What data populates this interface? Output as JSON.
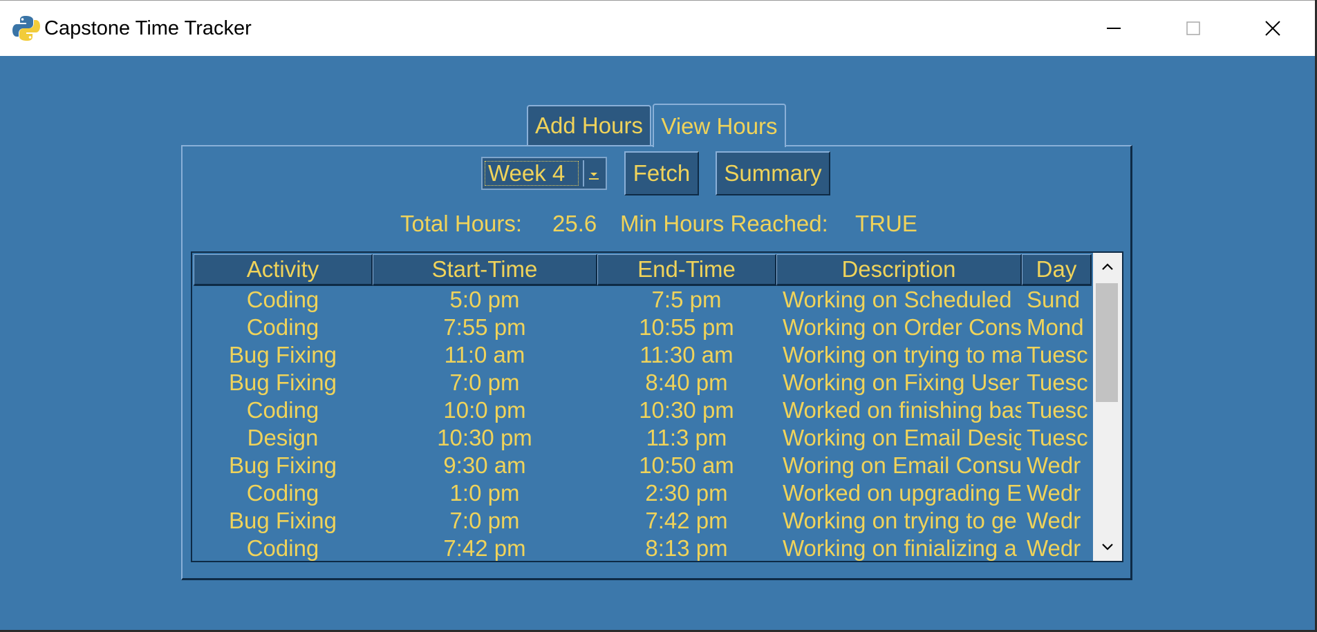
{
  "window": {
    "title": "Capstone Time Tracker",
    "icons": {
      "app": "python-icon",
      "minimize": "minimize-icon",
      "maximize": "maximize-icon",
      "close": "close-icon"
    }
  },
  "tabs": [
    {
      "label": "Add Hours",
      "active": false
    },
    {
      "label": "View Hours",
      "active": true
    }
  ],
  "controls": {
    "week_select": {
      "value": "Week 4"
    },
    "fetch_label": "Fetch",
    "summary_label": "Summary"
  },
  "stats": {
    "total_label": "Total Hours:",
    "total_value": "25.6",
    "min_label": "Min Hours Reached:",
    "min_value": "TRUE"
  },
  "table": {
    "columns": [
      "Activity",
      "Start-Time",
      "End-Time",
      "Description",
      "Day"
    ],
    "rows": [
      [
        "Coding",
        "5:0 pm",
        "7:5 pm",
        "Working on Scheduled",
        "Sund"
      ],
      [
        "Coding",
        "7:55 pm",
        "10:55 pm",
        "Working on Order Cons",
        "Mond"
      ],
      [
        "Bug Fixing",
        "11:0 am",
        "11:30 am",
        "Working on trying to ma",
        "Tuesc"
      ],
      [
        "Bug Fixing",
        "7:0 pm",
        "8:40 pm",
        "Working on Fixing User",
        "Tuesc"
      ],
      [
        "Coding",
        "10:0 pm",
        "10:30 pm",
        "Worked on finishing bas",
        "Tuesc"
      ],
      [
        "Design",
        "10:30 pm",
        "11:3 pm",
        "Working on Email Desig",
        "Tuesc"
      ],
      [
        "Bug Fixing",
        "9:30 am",
        "10:50 am",
        "Woring on Email Consu",
        "Wedr"
      ],
      [
        "Coding",
        "1:0 pm",
        "2:30 pm",
        "Worked on upgrading E",
        "Wedr"
      ],
      [
        "Bug Fixing",
        "7:0 pm",
        "7:42 pm",
        "Working on trying to ge",
        "Wedr"
      ],
      [
        "Coding",
        "7:42 pm",
        "8:13 pm",
        "Working on finializing a",
        "Wedr"
      ]
    ]
  },
  "colors": {
    "background": "#3c78ab",
    "text": "#f0d35a",
    "header": "#2c5880"
  }
}
